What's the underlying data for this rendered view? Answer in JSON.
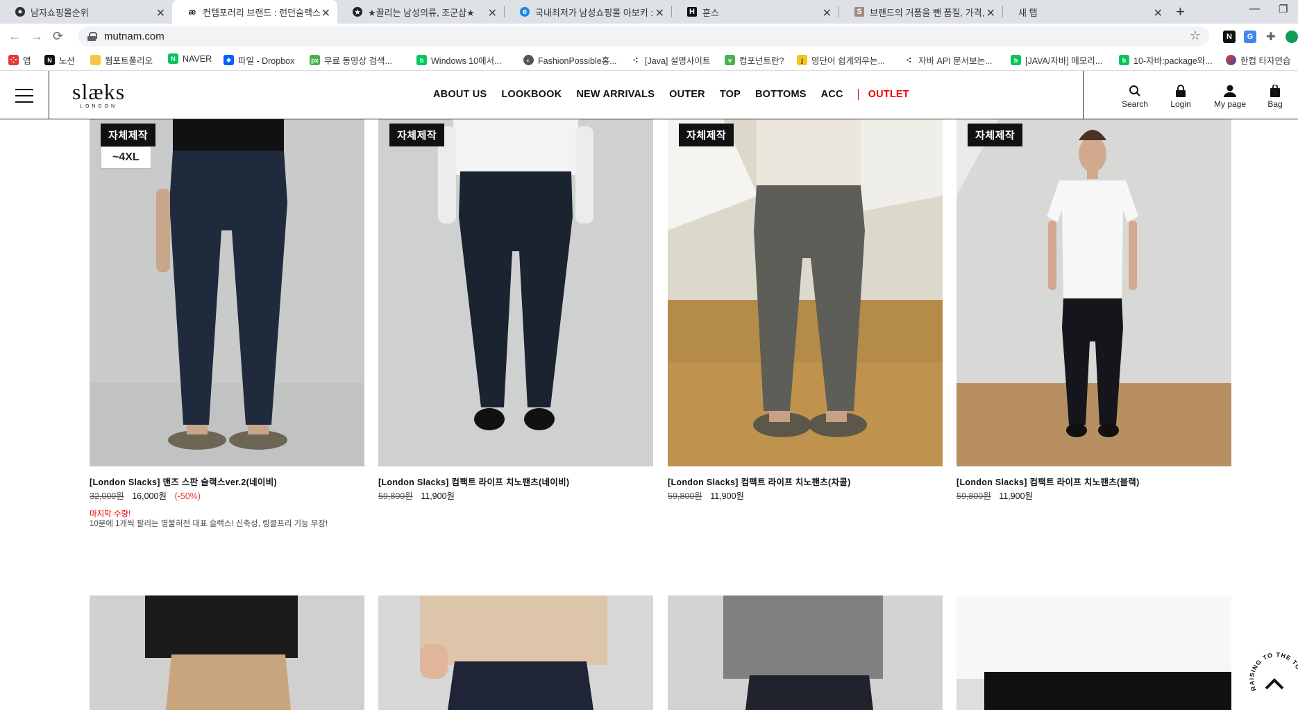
{
  "browser": {
    "tabs": [
      {
        "label": "남자쇼핑몰순위",
        "active": false
      },
      {
        "label": "컨템포러리 브랜드 : 런던슬랙스",
        "active": true
      },
      {
        "label": "★끌리는 남성의류, 조군샵★",
        "active": false
      },
      {
        "label": "국내최저가 남성쇼핑몰 아보키 :",
        "active": false
      },
      {
        "label": "훈스",
        "active": false
      },
      {
        "label": "브랜드의 거품을 뺀 품질, 가격,",
        "active": false
      },
      {
        "label": "새 탭",
        "active": false
      }
    ],
    "url": "mutnam.com",
    "bookmarks": [
      "앱",
      "노션",
      "웹포트폴리오",
      "NAVER",
      "파일 - Dropbox",
      "무료 동영상 검색...",
      "Windows 10에서...",
      "FashionPossible홍...",
      "[Java] 설명사이트",
      "컴포넌트란?",
      "영단어 쉽게외우는...",
      "자바 API 문서보는...",
      "[JAVA/자바] 메모리...",
      "10-자바:package와...",
      "한컴 타자연습"
    ]
  },
  "header": {
    "logo": "slæks",
    "logo_sub": "LONDON",
    "nav": [
      "ABOUT US",
      "LOOKBOOK",
      "NEW ARRIVALS",
      "OUTER",
      "TOP",
      "BOTTOMS",
      "ACC"
    ],
    "outlet": "OUTLET",
    "utils": [
      "Search",
      "Login",
      "My page",
      "Bag"
    ]
  },
  "products": [
    {
      "badge": "자체제작",
      "size_badge": "~4XL",
      "name": "[London Slacks] 맨즈 스판 슬랙스ver.2(네이비)",
      "original_price": "32,000원",
      "sale_price": "16,000원",
      "discount": "(-50%)",
      "note_red": "마지막 수량!",
      "note": "10분에 1개씩 팔리는 명불허전 대표 슬랙스! 신축성, 링클프리 기능 무장!",
      "pants_color": "#1f2a3d",
      "bg_color": "#c9cbcb"
    },
    {
      "badge": "자체제작",
      "name": "[London Slacks] 컴팩트 라이프 치노팬츠(네이비)",
      "original_price": "59,800원",
      "sale_price": "11,900원",
      "pants_color": "#1b2230",
      "bg_color": "#cfd0d0"
    },
    {
      "badge": "자체제작",
      "name": "[London Slacks] 컴팩트 라이프 치노팬츠(차콜)",
      "original_price": "59,800원",
      "sale_price": "11,900원",
      "pants_color": "#5d5e57",
      "bg_color": "#c8b894"
    },
    {
      "badge": "자체제작",
      "name": "[London Slacks] 컴팩트 라이프 치노팬츠(블랙)",
      "original_price": "59,800원",
      "sale_price": "11,900원",
      "pants_color": "#15161b",
      "bg_color": "#d8d8d6"
    }
  ],
  "next_row": [
    {
      "pants_color": "#c9a57d",
      "top_color": "#1a1a1a",
      "bg_color": "#d0d0d0"
    },
    {
      "pants_color": "#1f2537",
      "top_color": "#ddc5aa",
      "bg_color": "#d7d7d7"
    },
    {
      "pants_color": "#20232b",
      "top_color": "#808080",
      "bg_color": "#d2d2d2"
    },
    {
      "pants_color": "#101010",
      "top_color": "#f7f7f7",
      "bg_color": "#dedede"
    }
  ],
  "scroll_top_label": "RAISING TO THE TOP"
}
